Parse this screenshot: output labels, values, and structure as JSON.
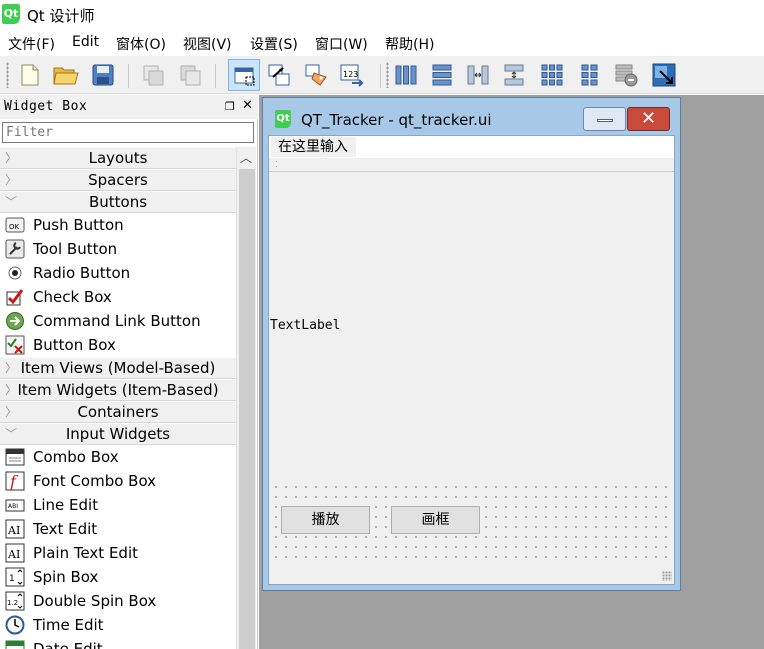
{
  "app": {
    "title": "Qt 设计师",
    "logo_text": "Qt"
  },
  "menu": [
    {
      "label": "文件(F)"
    },
    {
      "label": "Edit"
    },
    {
      "label": "窗体(O)"
    },
    {
      "label": "视图(V)"
    },
    {
      "label": "设置(S)"
    },
    {
      "label": "窗口(W)"
    },
    {
      "label": "帮助(H)"
    }
  ],
  "toolbar": {
    "buttons": [
      "new-file-icon",
      "open-folder-icon",
      "save-icon",
      "copy-icon",
      "paste-icon",
      "edit-widgets-icon",
      "edit-signals-slots-icon",
      "edit-buddies-icon",
      "edit-tab-order-icon",
      "layout-horizontal-icon",
      "layout-vertical-icon",
      "layout-horizontal-splitter-icon",
      "layout-vertical-splitter-icon",
      "layout-grid-icon",
      "layout-form-icon",
      "break-layout-icon",
      "adjust-size-icon"
    ]
  },
  "widget_box": {
    "title": "Widget Box",
    "filter_placeholder": "Filter",
    "sections": [
      {
        "label": "Layouts",
        "expanded": false,
        "items": []
      },
      {
        "label": "Spacers",
        "expanded": false,
        "items": []
      },
      {
        "label": "Buttons",
        "expanded": true,
        "items": [
          {
            "label": "Push Button",
            "icon": "push-button-icon"
          },
          {
            "label": "Tool Button",
            "icon": "tool-button-icon"
          },
          {
            "label": "Radio Button",
            "icon": "radio-button-icon"
          },
          {
            "label": "Check Box",
            "icon": "check-box-icon"
          },
          {
            "label": "Command Link Button",
            "icon": "command-link-icon"
          },
          {
            "label": "Button Box",
            "icon": "button-box-icon"
          }
        ]
      },
      {
        "label": "Item Views (Model-Based)",
        "expanded": false,
        "items": []
      },
      {
        "label": "Item Widgets (Item-Based)",
        "expanded": false,
        "items": []
      },
      {
        "label": "Containers",
        "expanded": false,
        "items": []
      },
      {
        "label": "Input Widgets",
        "expanded": true,
        "items": [
          {
            "label": "Combo Box",
            "icon": "combo-box-icon"
          },
          {
            "label": "Font Combo Box",
            "icon": "font-combo-box-icon"
          },
          {
            "label": "Line Edit",
            "icon": "line-edit-icon"
          },
          {
            "label": "Text Edit",
            "icon": "text-edit-icon"
          },
          {
            "label": "Plain Text Edit",
            "icon": "plain-text-edit-icon"
          },
          {
            "label": "Spin Box",
            "icon": "spin-box-icon"
          },
          {
            "label": "Double Spin Box",
            "icon": "double-spin-box-icon"
          },
          {
            "label": "Time Edit",
            "icon": "time-edit-icon"
          },
          {
            "label": "Date Edit",
            "icon": "date-edit-icon"
          }
        ]
      }
    ]
  },
  "form": {
    "title": "QT_Tracker - qt_tracker.ui",
    "menu_placeholder": "在这里输入",
    "text_label": "TextLabel",
    "buttons": [
      {
        "label": "播放"
      },
      {
        "label": "画框"
      }
    ]
  },
  "colors": {
    "accent": "#cce4f7",
    "close_red": "#c84a3a",
    "qt_green": "#41cd52",
    "form_frame": "#a8c8e8",
    "canvas": "#a0a0a0"
  }
}
